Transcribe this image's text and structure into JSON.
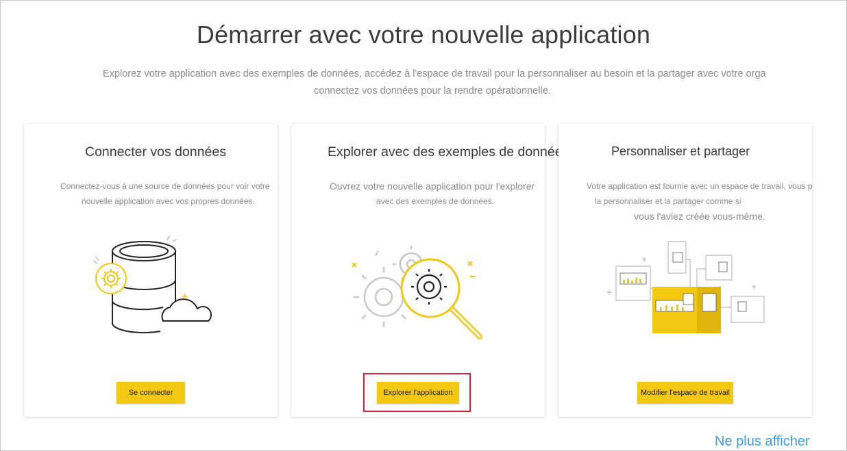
{
  "header": {
    "title": "Démarrer avec votre nouvelle application",
    "subtitle_line1": "Explorez votre application avec des exemples de données, accédez à l'espace de travail pour la personnaliser au besoin et la partager avec votre orga",
    "subtitle_line2": "connectez vos données pour la rendre opérationnelle."
  },
  "cards": [
    {
      "title": "Connecter vos données",
      "desc_line1": "Connectez-vous à une source de données pour voir votre",
      "desc_line2": "nouvelle application avec vos propres données.",
      "button_label": "Se connecter",
      "icon": "database-cloud-gear-icon"
    },
    {
      "title": "Explorer avec des exemples de données",
      "desc_line1": "Ouvrez votre nouvelle application pour l'explorer",
      "desc_line2": "avec des exemples de données.",
      "button_label": "Explorer l'application",
      "icon": "gears-magnifier-icon"
    },
    {
      "title": "Personnaliser et partager",
      "desc_line1": "Votre application est fournie avec un espace de travail, vous pou",
      "desc_line2": "la personnaliser et la partager comme si",
      "desc_line3": "vous l'aviez créée vous-même.",
      "button_label": "Modifier l'espace de travail",
      "icon": "dashboard-share-icon"
    }
  ],
  "footer": {
    "dismiss_link": "Ne plus afficher"
  },
  "colors": {
    "accent": "#f2c811",
    "link": "#3c9de0",
    "highlight": "#d6203a"
  }
}
